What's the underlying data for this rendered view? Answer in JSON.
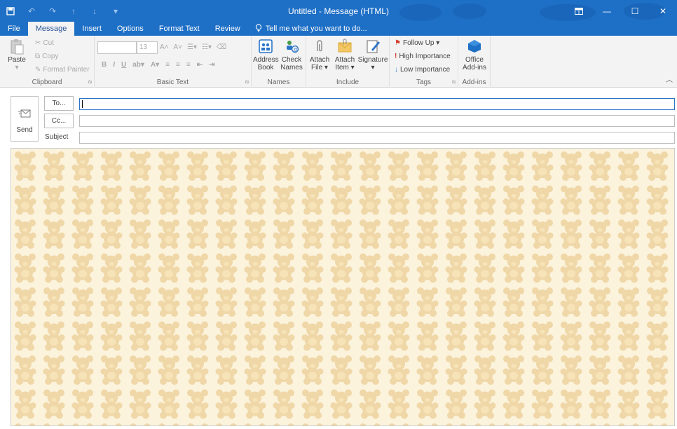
{
  "window": {
    "title": "Untitled - Message (HTML)",
    "accent": "#1e6fc6"
  },
  "qat": {
    "save_icon": "save-icon",
    "undo_icon": "undo-icon",
    "redo_icon": "redo-icon",
    "up_icon": "arrow-up-icon",
    "down_icon": "arrow-down-icon",
    "customize_icon": "customize-qat-icon"
  },
  "tabs": [
    {
      "label": "File"
    },
    {
      "label": "Message"
    },
    {
      "label": "Insert"
    },
    {
      "label": "Options"
    },
    {
      "label": "Format Text"
    },
    {
      "label": "Review"
    }
  ],
  "tell_me": "Tell me what you want to do...",
  "ribbon": {
    "clipboard": {
      "label": "Clipboard",
      "paste": "Paste",
      "cut": "Cut",
      "copy": "Copy",
      "format_painter": "Format Painter"
    },
    "basic_text": {
      "label": "Basic Text",
      "font_size": "13",
      "bold": "B",
      "italic": "I",
      "underline": "U"
    },
    "names": {
      "label": "Names",
      "address_book_1": "Address",
      "address_book_2": "Book",
      "check_names_1": "Check",
      "check_names_2": "Names"
    },
    "include": {
      "label": "Include",
      "attach_file_1": "Attach",
      "attach_file_2": "File ▾",
      "attach_item_1": "Attach",
      "attach_item_2": "Item ▾",
      "signature_1": "Signature",
      "signature_2": "▾"
    },
    "tags": {
      "label": "Tags",
      "follow_up": "Follow Up ▾",
      "high_importance": "High Importance",
      "low_importance": "Low Importance"
    },
    "addins": {
      "label": "Add-ins",
      "office_1": "Office",
      "office_2": "Add-ins"
    }
  },
  "compose": {
    "send": "Send",
    "to": "To...",
    "cc": "Cc...",
    "subject": "Subject",
    "to_value": "",
    "cc_value": "",
    "subject_value": ""
  },
  "stationery": {
    "background": "#fbf3dc",
    "motif": "teddy-bear-icon",
    "motif_color": "#f0d7a8"
  }
}
